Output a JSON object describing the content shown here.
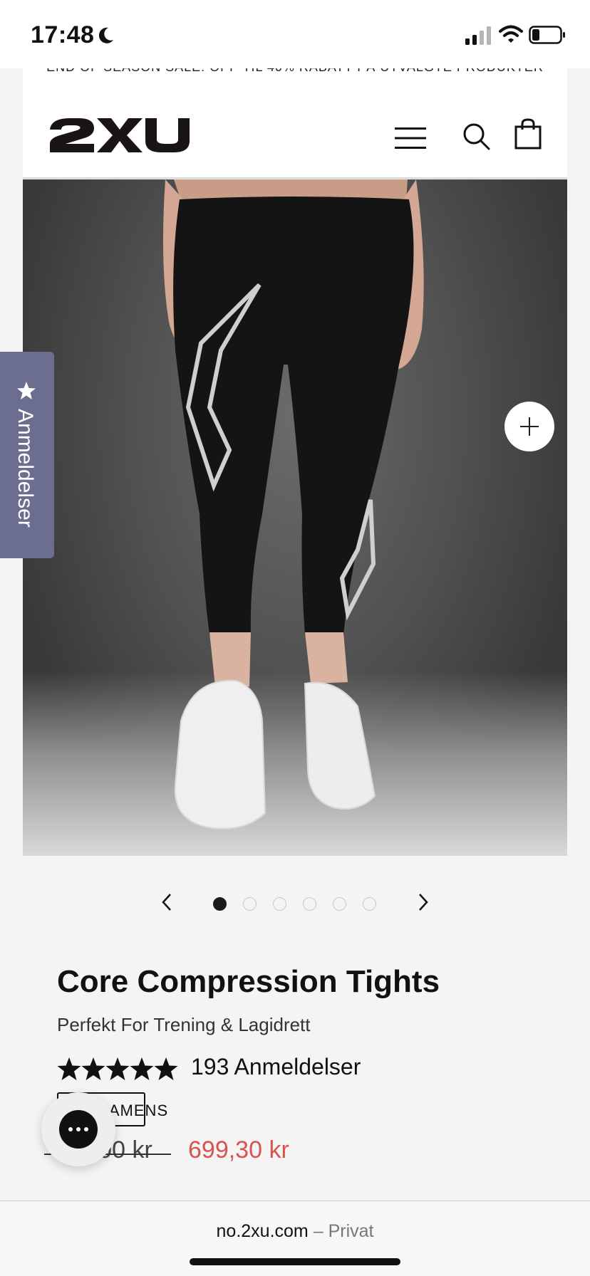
{
  "status_bar": {
    "time": "17:48"
  },
  "header": {
    "announcement": "END OF SEASON SALE! OPP TIL 40% RABATT PÅ UTVALGTE PRODUKTER",
    "logo_text": "2XU"
  },
  "reviews_tab": {
    "label": "Anmeldelser"
  },
  "carousel": {
    "total_images": 6,
    "active_index": 0
  },
  "product": {
    "title": "Core Compression Tights",
    "subtitle": "Perfekt For Trening & Lagidrett",
    "rating": 5,
    "review_count_label": "193 Anmeldelser",
    "gender_badge": "DAMENS",
    "price_old": "999,00 kr",
    "price_new": "699,30 kr"
  },
  "browser": {
    "domain": "no.2xu.com",
    "separator": " – ",
    "mode": "Privat"
  },
  "colors": {
    "sale_price": "#d9534f",
    "reviews_tab": "#6b6e8f"
  },
  "icons": {
    "moon": "moon-icon",
    "signal": "signal-icon",
    "wifi": "wifi-icon",
    "battery": "battery-icon",
    "menu": "menu-icon",
    "search": "search-icon",
    "bag": "shopping-bag-icon",
    "zoom": "plus-icon",
    "chat": "chat-icon"
  }
}
